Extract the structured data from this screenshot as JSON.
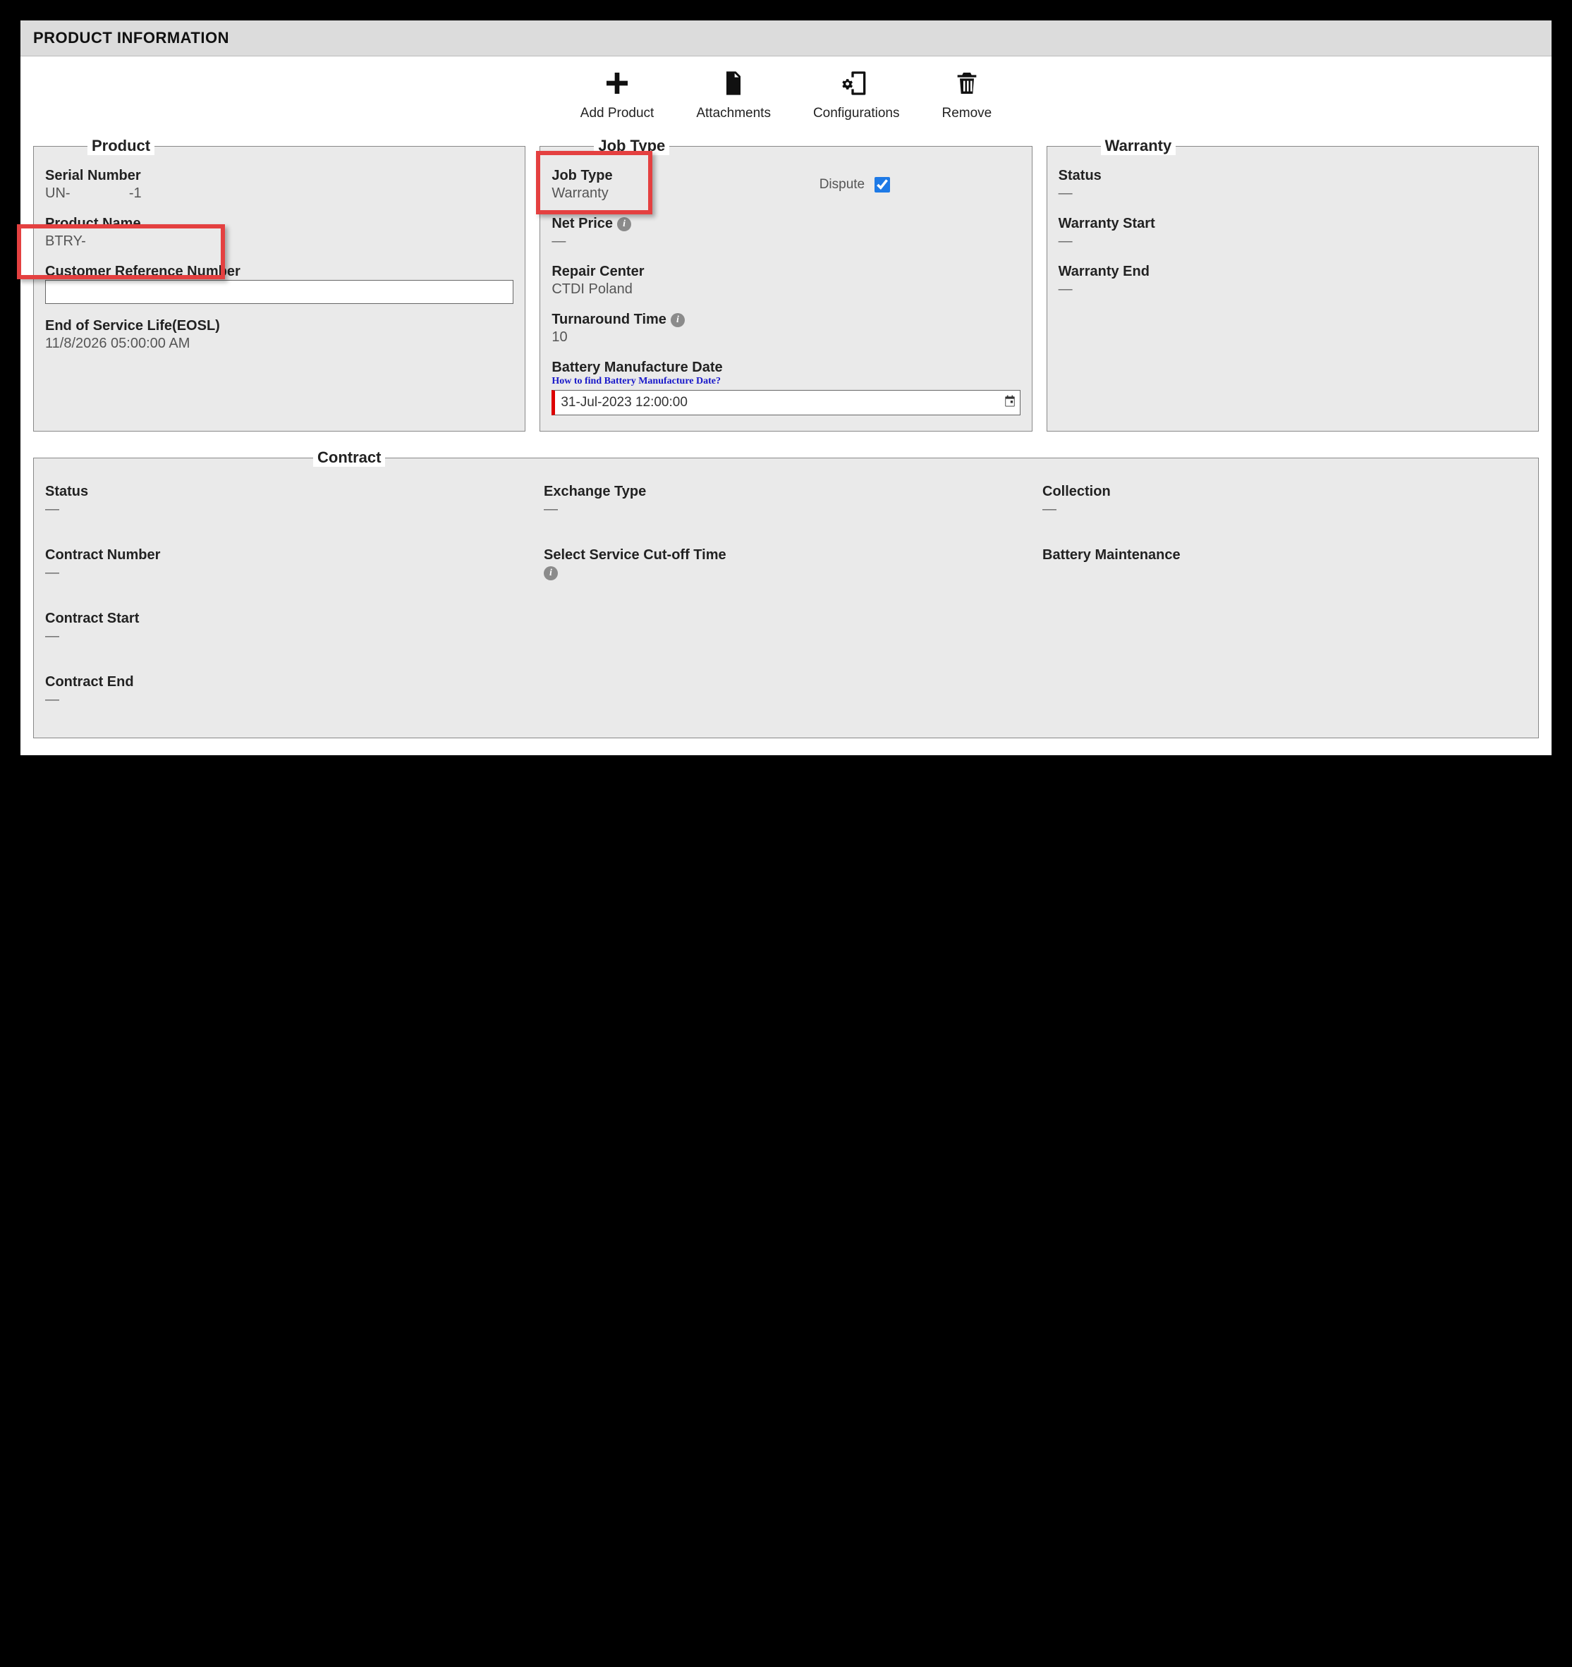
{
  "header": {
    "title": "PRODUCT INFORMATION"
  },
  "toolbar": {
    "add_product": "Add Product",
    "attachments": "Attachments",
    "configurations": "Configurations",
    "remove": "Remove"
  },
  "product": {
    "legend": "Product",
    "serial_label": "Serial Number",
    "serial_value": "UN-               -1",
    "name_label": "Product Name",
    "name_value": "BTRY-",
    "crn_label": "Customer Reference Number",
    "crn_value": "",
    "eosl_label": "End of Service Life(EOSL)",
    "eosl_value": "11/8/2026 05:00:00 AM"
  },
  "jobtype": {
    "legend": "Job Type",
    "jobtype_label": "Job Type",
    "jobtype_value": "Warranty",
    "dispute_label": "Dispute",
    "dispute_checked": true,
    "netprice_label": "Net Price",
    "netprice_value": "—",
    "repair_center_label": "Repair Center",
    "repair_center_value": "CTDI Poland",
    "turnaround_label": "Turnaround Time",
    "turnaround_value": "10",
    "battery_date_label": "Battery Manufacture Date",
    "battery_date_help": "How to find Battery Manufacture Date?",
    "battery_date_value": "31-Jul-2023 12:00:00"
  },
  "warranty": {
    "legend": "Warranty",
    "status_label": "Status",
    "status_value": "—",
    "start_label": "Warranty Start",
    "start_value": "—",
    "end_label": "Warranty End",
    "end_value": "—"
  },
  "contract": {
    "legend": "Contract",
    "status_label": "Status",
    "status_value": "—",
    "exchange_label": "Exchange Type",
    "exchange_value": "—",
    "collection_label": "Collection",
    "collection_value": "—",
    "number_label": "Contract Number",
    "number_value": "—",
    "cutoff_label": "Select Service Cut-off Time",
    "cutoff_value": "",
    "battery_maint_label": "Battery Maintenance",
    "battery_maint_value": "",
    "start_label": "Contract Start",
    "start_value": "—",
    "end_label": "Contract End",
    "end_value": "—"
  }
}
